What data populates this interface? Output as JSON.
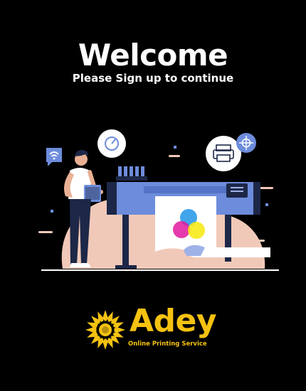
{
  "header": {
    "title": "Welcome",
    "subtitle": "Please Sign up to continue"
  },
  "illustration": {
    "icons": [
      "wifi-icon",
      "clock-icon",
      "printer-icon",
      "crosshair-icon",
      "color-circles-icon"
    ]
  },
  "brand": {
    "name": "Adey",
    "tagline": "Online Printing Service",
    "icon": "sun-icon"
  },
  "colors": {
    "background": "#000000",
    "text": "#ffffff",
    "brand": "#f5c211",
    "accent_blue": "#6d8cdb",
    "accent_peach": "#f1c9b9",
    "navy": "#1d2747"
  }
}
